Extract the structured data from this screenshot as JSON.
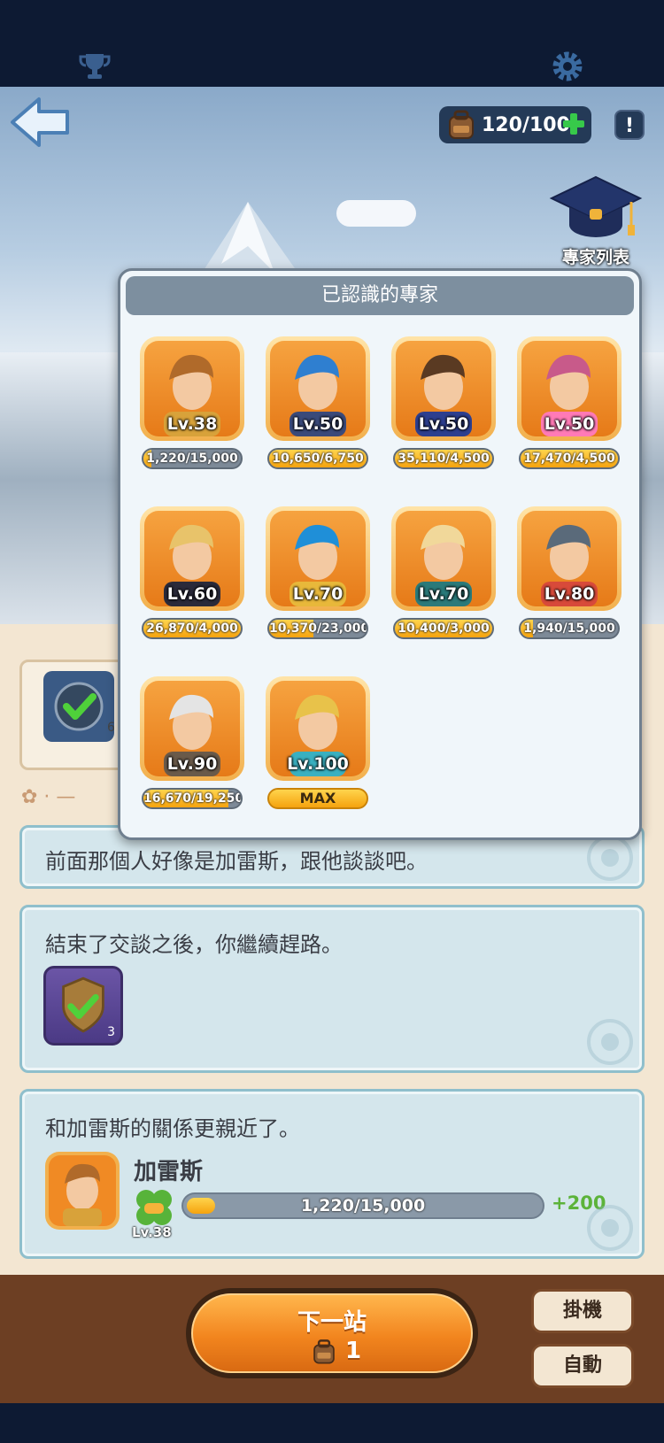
{
  "header": {
    "trophy_icon": "trophy-icon",
    "gear_icon": "gear-icon",
    "back_icon": "back-arrow-icon",
    "resource": "120/100",
    "info_label": "!",
    "expert_list_label": "專家列表"
  },
  "popup": {
    "title": "已認識的專家",
    "experts": [
      {
        "level": "Lv.38",
        "progress": "1,220/15,000",
        "fill": 0.08,
        "hair": "#b06a2a",
        "outfit": "#d8a23a"
      },
      {
        "level": "Lv.50",
        "progress": "10,650/6,750",
        "fill": 1.0,
        "hair": "#2f7fd0",
        "outfit": "#3a4a7a"
      },
      {
        "level": "Lv.50",
        "progress": "35,110/4,500",
        "fill": 1.0,
        "hair": "#5a3a22",
        "outfit": "#2d3f8f"
      },
      {
        "level": "Lv.50",
        "progress": "17,470/4,500",
        "fill": 1.0,
        "hair": "#c85a8a",
        "outfit": "#ff7ab6"
      },
      {
        "level": "Lv.60",
        "progress": "26,870/4,000",
        "fill": 1.0,
        "hair": "#e8c36a",
        "outfit": "#2a2a3a"
      },
      {
        "level": "Lv.70",
        "progress": "10,370/23,000",
        "fill": 0.45,
        "hair": "#1f8fd8",
        "outfit": "#e8b83a"
      },
      {
        "level": "Lv.70",
        "progress": "10,400/3,000",
        "fill": 1.0,
        "hair": "#f1d89a",
        "outfit": "#2a7a7a"
      },
      {
        "level": "Lv.80",
        "progress": "1,940/15,000",
        "fill": 0.13,
        "hair": "#5a6a7a",
        "outfit": "#d84a3a"
      },
      {
        "level": "Lv.90",
        "progress": "16,670/19,250",
        "fill": 0.87,
        "hair": "#e4e4e4",
        "outfit": "#6a5a4a"
      },
      {
        "level": "Lv.100",
        "progress": "MAX",
        "fill": 1.0,
        "hair": "#e8c24a",
        "outfit": "#3ab0c0"
      }
    ]
  },
  "quest": {
    "check_icon": "check-medal-icon",
    "count": "6"
  },
  "messages": {
    "m1": "前面那個人好像是加雷斯，跟他談談吧。",
    "m2": "結束了交談之後，你繼續趕路。",
    "m2_reward_count": "3",
    "m3": "和加雷斯的關係更親近了。",
    "rel_name": "加雷斯",
    "rel_level": "Lv.38",
    "rel_progress": "1,220/15,000",
    "rel_fill": 0.08,
    "rel_gain": "+200"
  },
  "actions": {
    "next_title": "下一站",
    "next_cost": "1",
    "idle_label": "掛機",
    "auto_label": "自動"
  },
  "colors": {
    "accent_orange": "#f2851e",
    "bar_gold": "#f5a30e",
    "gain_green": "#5cb33a"
  }
}
